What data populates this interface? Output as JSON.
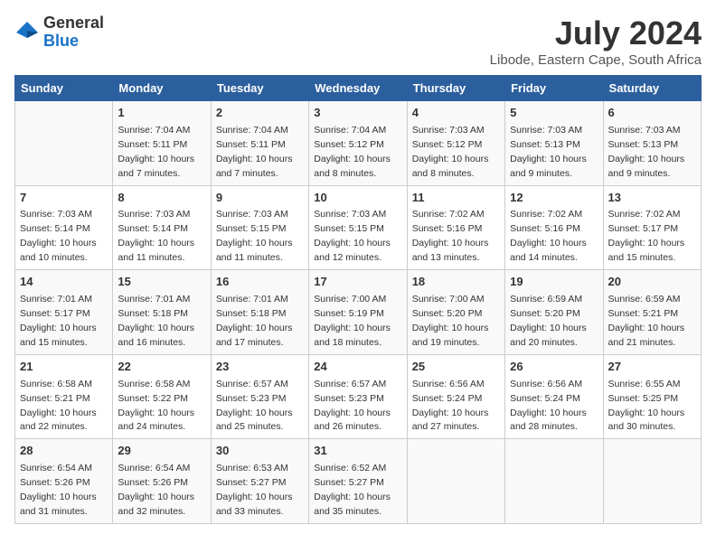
{
  "logo": {
    "general": "General",
    "blue": "Blue"
  },
  "title": "July 2024",
  "subtitle": "Libode, Eastern Cape, South Africa",
  "headers": [
    "Sunday",
    "Monday",
    "Tuesday",
    "Wednesday",
    "Thursday",
    "Friday",
    "Saturday"
  ],
  "weeks": [
    [
      {
        "day": "",
        "info": ""
      },
      {
        "day": "1",
        "info": "Sunrise: 7:04 AM\nSunset: 5:11 PM\nDaylight: 10 hours\nand 7 minutes."
      },
      {
        "day": "2",
        "info": "Sunrise: 7:04 AM\nSunset: 5:11 PM\nDaylight: 10 hours\nand 7 minutes."
      },
      {
        "day": "3",
        "info": "Sunrise: 7:04 AM\nSunset: 5:12 PM\nDaylight: 10 hours\nand 8 minutes."
      },
      {
        "day": "4",
        "info": "Sunrise: 7:03 AM\nSunset: 5:12 PM\nDaylight: 10 hours\nand 8 minutes."
      },
      {
        "day": "5",
        "info": "Sunrise: 7:03 AM\nSunset: 5:13 PM\nDaylight: 10 hours\nand 9 minutes."
      },
      {
        "day": "6",
        "info": "Sunrise: 7:03 AM\nSunset: 5:13 PM\nDaylight: 10 hours\nand 9 minutes."
      }
    ],
    [
      {
        "day": "7",
        "info": "Sunrise: 7:03 AM\nSunset: 5:14 PM\nDaylight: 10 hours\nand 10 minutes."
      },
      {
        "day": "8",
        "info": "Sunrise: 7:03 AM\nSunset: 5:14 PM\nDaylight: 10 hours\nand 11 minutes."
      },
      {
        "day": "9",
        "info": "Sunrise: 7:03 AM\nSunset: 5:15 PM\nDaylight: 10 hours\nand 11 minutes."
      },
      {
        "day": "10",
        "info": "Sunrise: 7:03 AM\nSunset: 5:15 PM\nDaylight: 10 hours\nand 12 minutes."
      },
      {
        "day": "11",
        "info": "Sunrise: 7:02 AM\nSunset: 5:16 PM\nDaylight: 10 hours\nand 13 minutes."
      },
      {
        "day": "12",
        "info": "Sunrise: 7:02 AM\nSunset: 5:16 PM\nDaylight: 10 hours\nand 14 minutes."
      },
      {
        "day": "13",
        "info": "Sunrise: 7:02 AM\nSunset: 5:17 PM\nDaylight: 10 hours\nand 15 minutes."
      }
    ],
    [
      {
        "day": "14",
        "info": "Sunrise: 7:01 AM\nSunset: 5:17 PM\nDaylight: 10 hours\nand 15 minutes."
      },
      {
        "day": "15",
        "info": "Sunrise: 7:01 AM\nSunset: 5:18 PM\nDaylight: 10 hours\nand 16 minutes."
      },
      {
        "day": "16",
        "info": "Sunrise: 7:01 AM\nSunset: 5:18 PM\nDaylight: 10 hours\nand 17 minutes."
      },
      {
        "day": "17",
        "info": "Sunrise: 7:00 AM\nSunset: 5:19 PM\nDaylight: 10 hours\nand 18 minutes."
      },
      {
        "day": "18",
        "info": "Sunrise: 7:00 AM\nSunset: 5:20 PM\nDaylight: 10 hours\nand 19 minutes."
      },
      {
        "day": "19",
        "info": "Sunrise: 6:59 AM\nSunset: 5:20 PM\nDaylight: 10 hours\nand 20 minutes."
      },
      {
        "day": "20",
        "info": "Sunrise: 6:59 AM\nSunset: 5:21 PM\nDaylight: 10 hours\nand 21 minutes."
      }
    ],
    [
      {
        "day": "21",
        "info": "Sunrise: 6:58 AM\nSunset: 5:21 PM\nDaylight: 10 hours\nand 22 minutes."
      },
      {
        "day": "22",
        "info": "Sunrise: 6:58 AM\nSunset: 5:22 PM\nDaylight: 10 hours\nand 24 minutes."
      },
      {
        "day": "23",
        "info": "Sunrise: 6:57 AM\nSunset: 5:23 PM\nDaylight: 10 hours\nand 25 minutes."
      },
      {
        "day": "24",
        "info": "Sunrise: 6:57 AM\nSunset: 5:23 PM\nDaylight: 10 hours\nand 26 minutes."
      },
      {
        "day": "25",
        "info": "Sunrise: 6:56 AM\nSunset: 5:24 PM\nDaylight: 10 hours\nand 27 minutes."
      },
      {
        "day": "26",
        "info": "Sunrise: 6:56 AM\nSunset: 5:24 PM\nDaylight: 10 hours\nand 28 minutes."
      },
      {
        "day": "27",
        "info": "Sunrise: 6:55 AM\nSunset: 5:25 PM\nDaylight: 10 hours\nand 30 minutes."
      }
    ],
    [
      {
        "day": "28",
        "info": "Sunrise: 6:54 AM\nSunset: 5:26 PM\nDaylight: 10 hours\nand 31 minutes."
      },
      {
        "day": "29",
        "info": "Sunrise: 6:54 AM\nSunset: 5:26 PM\nDaylight: 10 hours\nand 32 minutes."
      },
      {
        "day": "30",
        "info": "Sunrise: 6:53 AM\nSunset: 5:27 PM\nDaylight: 10 hours\nand 33 minutes."
      },
      {
        "day": "31",
        "info": "Sunrise: 6:52 AM\nSunset: 5:27 PM\nDaylight: 10 hours\nand 35 minutes."
      },
      {
        "day": "",
        "info": ""
      },
      {
        "day": "",
        "info": ""
      },
      {
        "day": "",
        "info": ""
      }
    ]
  ]
}
